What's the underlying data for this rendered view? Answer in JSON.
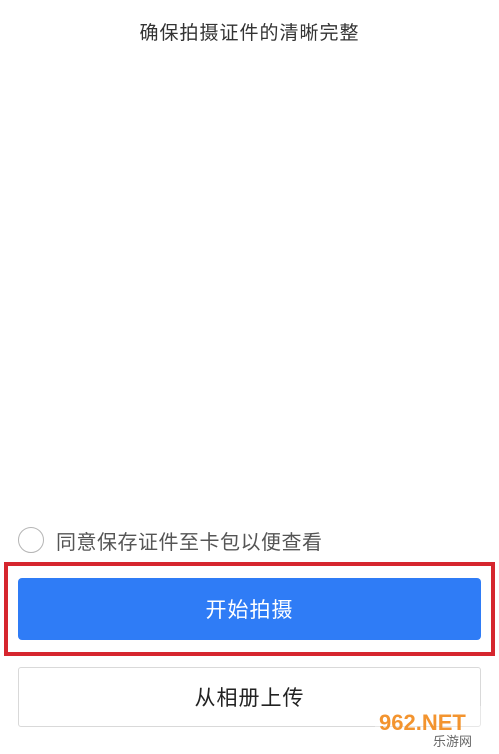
{
  "page": {
    "hint": "确保拍摄证件的清晰完整"
  },
  "agreement": {
    "label": "同意保存证件至卡包以便查看",
    "checked": false
  },
  "buttons": {
    "start_capture": "开始拍摄",
    "upload_from_album": "从相册上传"
  },
  "watermark": {
    "brand": "962.NET",
    "subtitle": "乐游网"
  },
  "colors": {
    "primary": "#2f7cf6",
    "highlight": "#d6262e"
  }
}
